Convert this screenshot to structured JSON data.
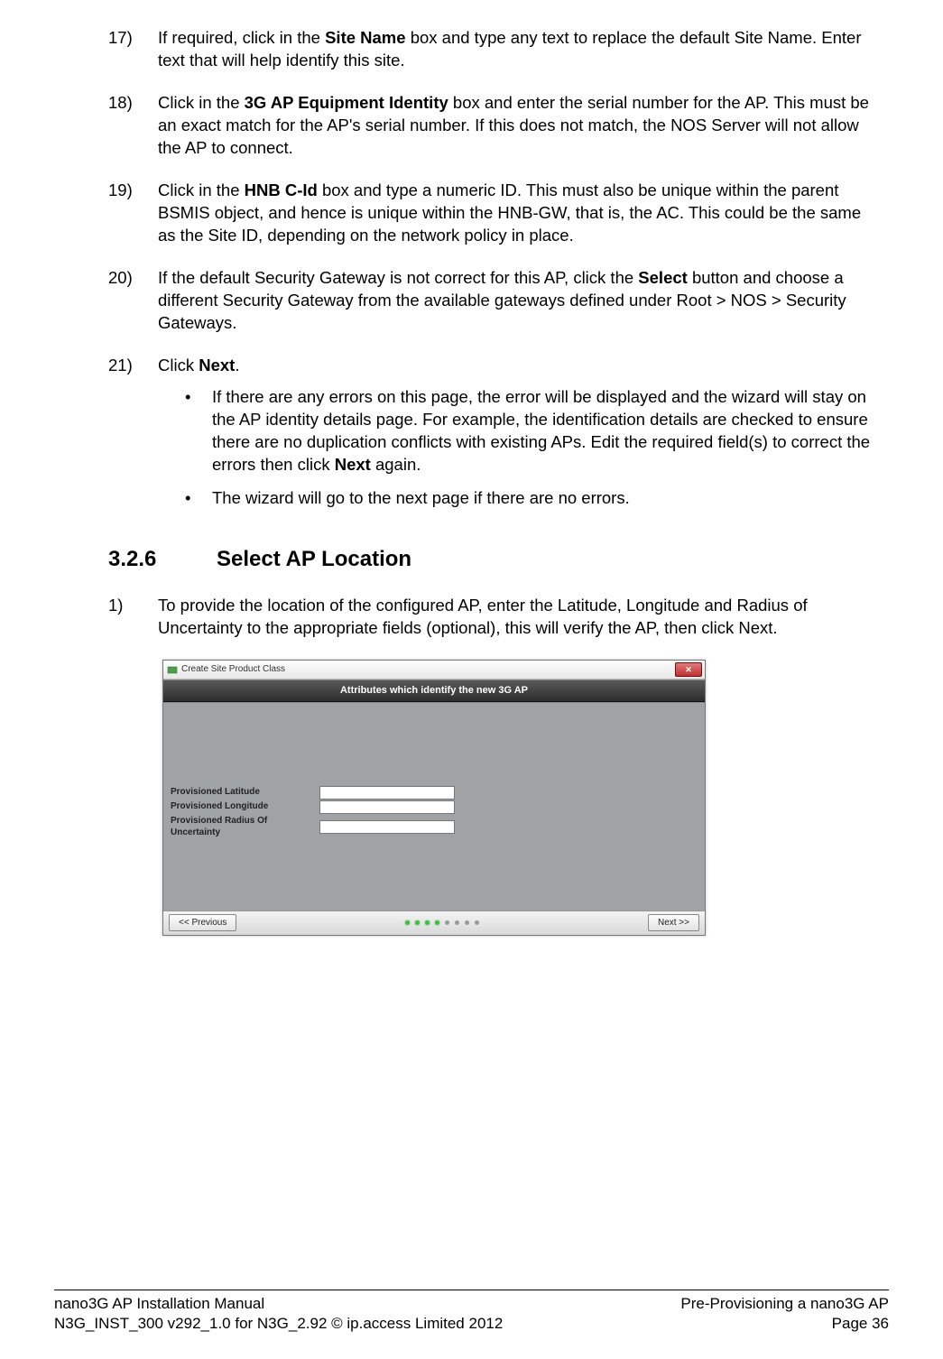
{
  "steps": [
    {
      "num": "17)",
      "runs": [
        {
          "t": "If required, click in the "
        },
        {
          "t": "Site Name",
          "b": true
        },
        {
          "t": " box and type any text to replace the default Site Name. Enter text that will help identify this site."
        }
      ]
    },
    {
      "num": "18)",
      "runs": [
        {
          "t": "Click in the "
        },
        {
          "t": "3G AP Equipment Identity",
          "b": true
        },
        {
          "t": " box and enter the serial number for the AP. This must be an exact match for the AP's serial number. If this does not match, the NOS Server will not allow the AP to connect."
        }
      ]
    },
    {
      "num": "19)",
      "runs": [
        {
          "t": "Click in the "
        },
        {
          "t": "HNB C-Id",
          "b": true
        },
        {
          "t": " box and type a numeric ID. This must also be unique within the parent BSMIS object, and hence is unique within the HNB-GW, that is, the AC. This could be the same as the Site ID, depending on the network policy in place."
        }
      ]
    },
    {
      "num": "20)",
      "runs": [
        {
          "t": "If the default Security Gateway is not correct for this AP, click the "
        },
        {
          "t": "Select",
          "b": true
        },
        {
          "t": " button and choose a different Security Gateway from the available gateways defined under Root > NOS > Security Gateways."
        }
      ]
    },
    {
      "num": "21)",
      "runs": [
        {
          "t": "Click "
        },
        {
          "t": "Next",
          "b": true
        },
        {
          "t": "."
        }
      ],
      "bullets": [
        {
          "runs": [
            {
              "t": " If there are any errors on this page, the error will be displayed and the wizard will stay on the AP identity details page. For example, the identification details are checked to ensure there are no duplication conflicts with existing APs. Edit the required field(s) to correct the errors then click "
            },
            {
              "t": "Next",
              "b": true
            },
            {
              "t": " again."
            }
          ]
        },
        {
          "runs": [
            {
              "t": "The wizard will go to the next page if there are no errors."
            }
          ]
        }
      ]
    }
  ],
  "section": {
    "num": "3.2.6",
    "title": "Select AP Location"
  },
  "substeps": [
    {
      "num": "1)",
      "runs": [
        {
          "t": "To provide the location of the configured AP, enter the Latitude, Longitude and Radius of Uncertainty to the appropriate fields (optional), this will verify the AP, then click Next."
        }
      ]
    }
  ],
  "dialog": {
    "title": "Create Site Product Class",
    "banner": "Attributes which identify the new 3G AP",
    "fields": [
      "Provisioned Latitude",
      "Provisioned Longitude",
      "Provisioned Radius Of Uncertainty"
    ],
    "prev": "<< Previous",
    "next": "Next >>",
    "greenDots": 4,
    "greyDots": 4
  },
  "footer": {
    "leftTop": "nano3G AP Installation Manual",
    "leftBot": "N3G_INST_300 v292_1.0 for N3G_2.92 © ip.access Limited 2012",
    "rightTop": "Pre-Provisioning a nano3G AP",
    "rightBot": "Page 36"
  }
}
